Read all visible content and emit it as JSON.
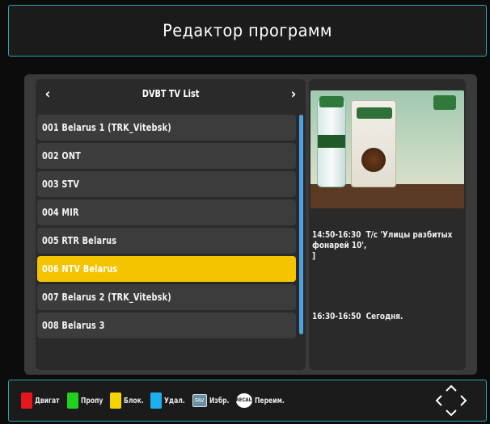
{
  "header": {
    "title": "Редактор программ"
  },
  "list": {
    "title": "DVBT TV List",
    "prev_icon": "chevron-left-icon",
    "next_icon": "chevron-right-icon",
    "channels": [
      {
        "label": "001 Belarus 1 (TRK_Vitebsk)"
      },
      {
        "label": "002 ONT"
      },
      {
        "label": "003 STV"
      },
      {
        "label": "004 MIR"
      },
      {
        "label": "005 RTR Belarus"
      },
      {
        "label": "006 NTV Belarus",
        "selected": true
      },
      {
        "label": "007 Belarus 2 (TRK_Vitebsk)"
      },
      {
        "label": "008 Belarus 3"
      }
    ]
  },
  "preview": {
    "description_icon": "tv-preview-image",
    "accent": "#2f7a3a"
  },
  "epg": {
    "now": "14:50-16:30  Т/с 'Улицы разбитых фонарей 10',\n]",
    "next": "16:30-16:50  Сегодня."
  },
  "footer": {
    "keys": [
      {
        "color": "#e8161c",
        "label": "Двигат"
      },
      {
        "color": "#20d21c",
        "label": "Пропу"
      },
      {
        "color": "#f6d400",
        "label": "Блок."
      },
      {
        "color": "#1cb0f0",
        "label": "Удал."
      },
      {
        "icon": "fav-key-icon",
        "icon_text": "FAV",
        "label": "Избр."
      },
      {
        "icon": "recall-key-icon",
        "icon_text": "RECALL",
        "label": "Переим."
      }
    ],
    "nav_icon": "navigation-arrows-icon"
  },
  "colors": {
    "frame_accent": "#2aa6a0",
    "selection": "#f5c400",
    "scrollbar": "#4aa3e0"
  }
}
